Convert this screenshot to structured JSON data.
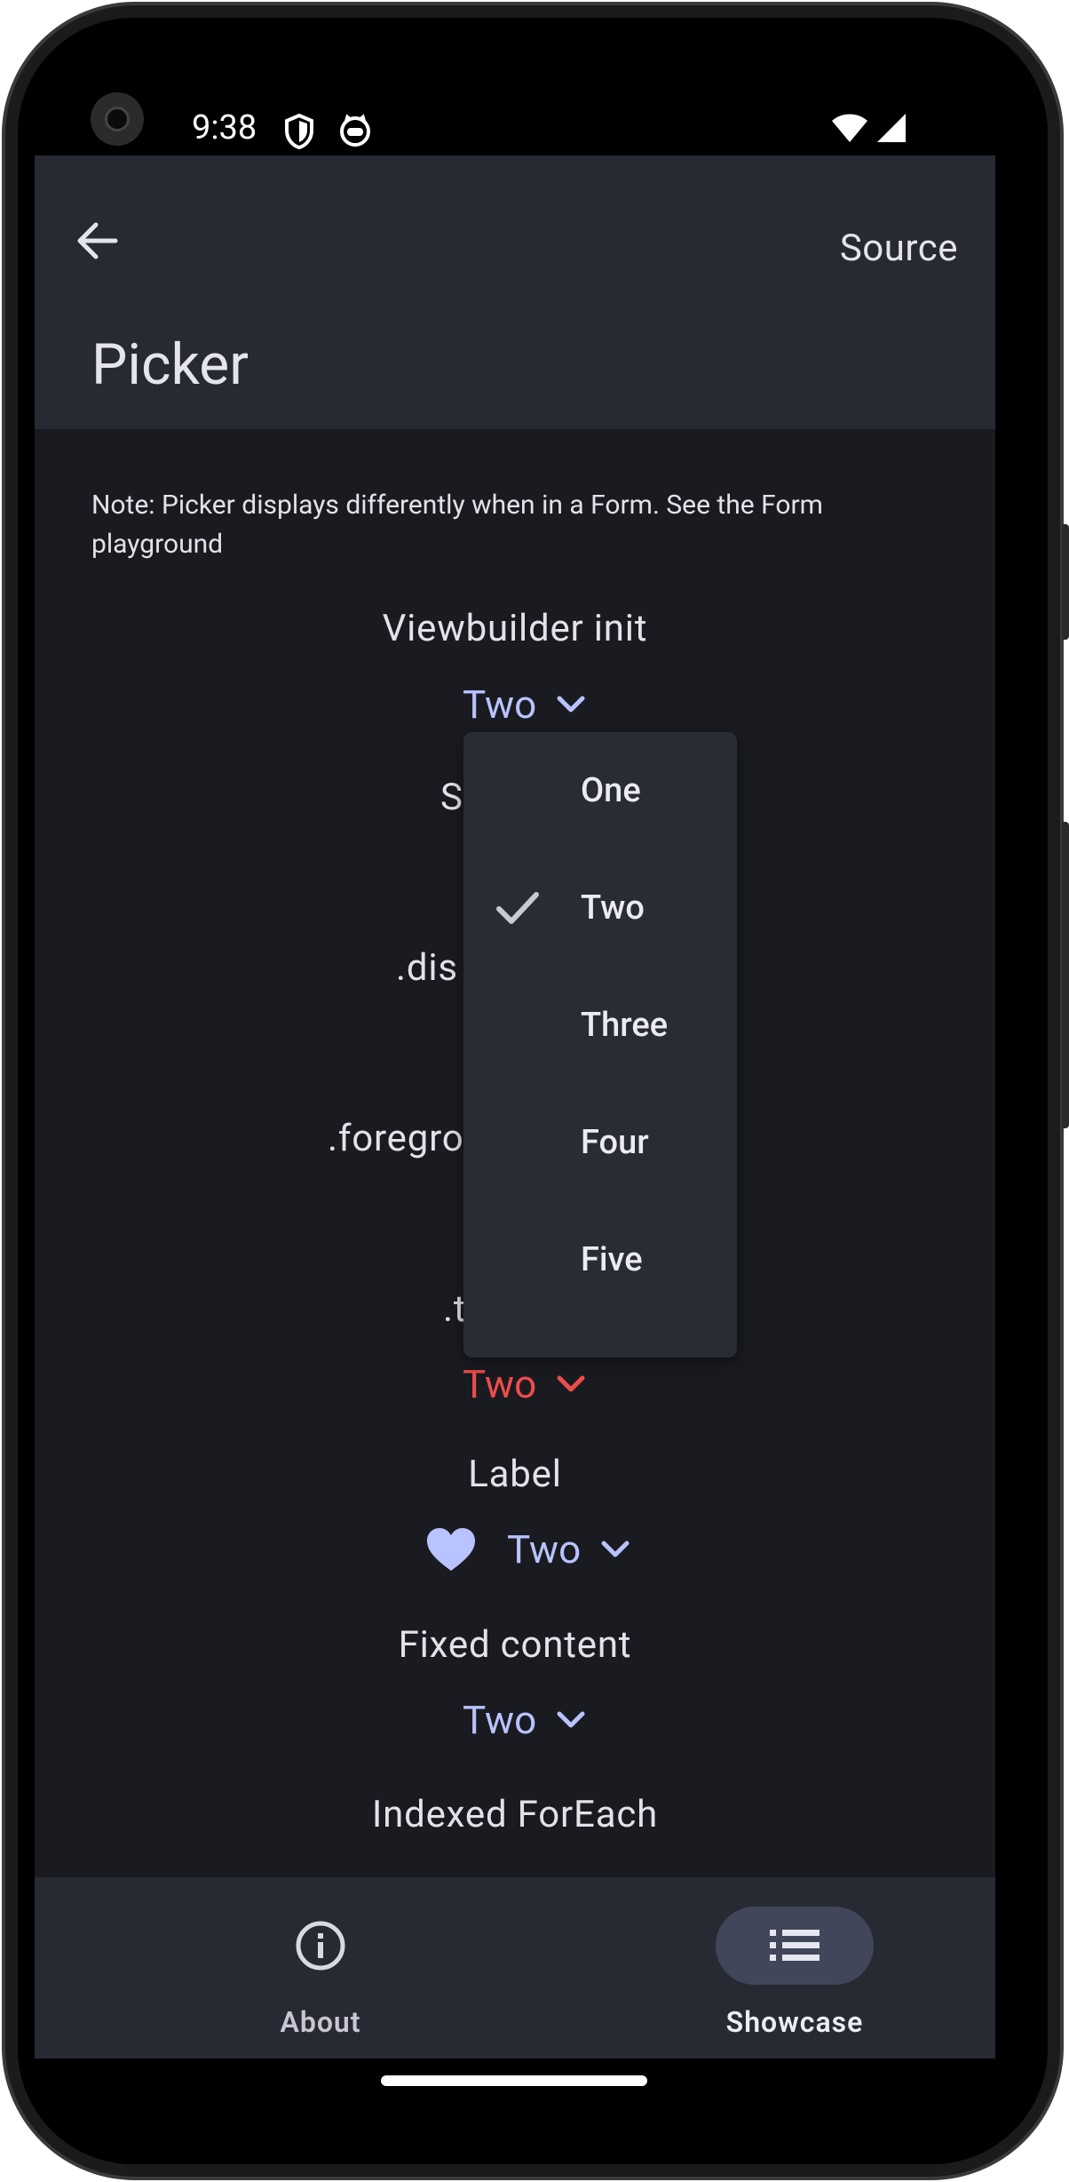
{
  "status_bar": {
    "time": "9:38",
    "icons": [
      "shield-icon",
      "cat-face-icon",
      "wifi-icon",
      "cell-signal-icon"
    ]
  },
  "header": {
    "back_icon": "arrow-left-icon",
    "source_label": "Source",
    "title": "Picker"
  },
  "content": {
    "note": "Note: Picker displays differently when in a Form. See the Form playground",
    "sections": {
      "viewbuilder_label": "Viewbuilder init",
      "viewbuilder_value": "Two",
      "second_label_partial": "S",
      "disabled_label_partial": ".dis",
      "foreground_label_partial": ".foregro",
      "tint_label_partial": ".t",
      "tint_value": "Two",
      "label_label": "Label",
      "label_value": "Two",
      "fixed_label": "Fixed content",
      "fixed_value": "Two",
      "indexed_label": "Indexed ForEach"
    }
  },
  "dropdown": {
    "items": [
      "One",
      "Two",
      "Three",
      "Four",
      "Five"
    ],
    "selected": "Two"
  },
  "bottom_nav": {
    "items": [
      {
        "label": "About",
        "icon": "info-icon",
        "active": false
      },
      {
        "label": "Showcase",
        "icon": "list-icon",
        "active": true
      }
    ]
  },
  "colors": {
    "background": "#1a1b21",
    "surface": "#282a33",
    "accent": "#b8c3ff",
    "tint_red": "#ef4d4a",
    "menu": "#2a2c35"
  }
}
